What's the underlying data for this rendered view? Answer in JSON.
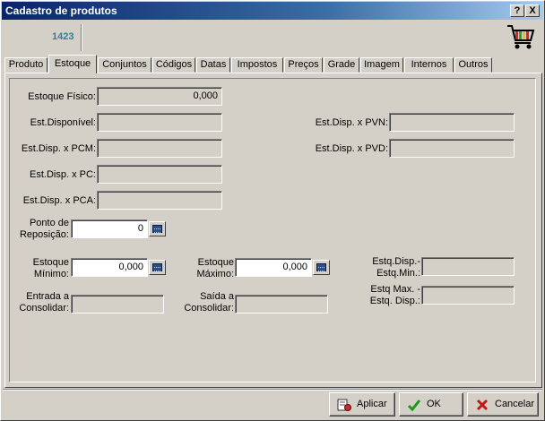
{
  "window": {
    "title": "Cadastro de produtos",
    "help_btn": "?",
    "close_btn": "X"
  },
  "header": {
    "product_code": "1423"
  },
  "tabs": [
    "Produto",
    "Estoque",
    "Conjuntos",
    "Códigos",
    "Datas",
    "Impostos",
    "Preços",
    "Grade",
    "Imagem",
    "Internos",
    "Outros"
  ],
  "active_tab": "Estoque",
  "fields": {
    "estoque_fisico": {
      "label": "Estoque Físico:",
      "value": "0,000"
    },
    "est_disponivel": {
      "label": "Est.Disponível:",
      "value": ""
    },
    "est_disp_pcm": {
      "label": "Est.Disp. x PCM:",
      "value": ""
    },
    "est_disp_pc": {
      "label": "Est.Disp. x PC:",
      "value": ""
    },
    "est_disp_pca": {
      "label": "Est.Disp. x PCA:",
      "value": ""
    },
    "est_disp_pvn": {
      "label": "Est.Disp. x PVN:",
      "value": ""
    },
    "est_disp_pvd": {
      "label": "Est.Disp. x PVD:",
      "value": ""
    },
    "ponto_reposicao": {
      "label_1": "Ponto de",
      "label_2": "Reposição:",
      "value": "0"
    },
    "estoque_minimo": {
      "label_1": "Estoque",
      "label_2": "Mínimo:",
      "value": "0,000"
    },
    "estoque_maximo": {
      "label_1": "Estoque",
      "label_2": "Máximo:",
      "value": "0,000"
    },
    "estq_disp_min": {
      "label_1": "Estq.Disp.-",
      "label_2": "Estq.Min.:",
      "value": ""
    },
    "estq_max_disp": {
      "label_1": "Estq Max. -",
      "label_2": "Estq. Disp.:",
      "value": ""
    },
    "entrada_consolidar": {
      "label_1": "Entrada a",
      "label_2": "Consolidar:",
      "value": ""
    },
    "saida_consolidar": {
      "label_1": "Saída a",
      "label_2": "Consolidar:",
      "value": ""
    }
  },
  "buttons": {
    "apply": "Aplicar",
    "ok": "OK",
    "cancel": "Cancelar"
  },
  "colors": {
    "title_start": "#0a246a",
    "code_text": "#2f7f95",
    "face": "#d4d0c8"
  }
}
